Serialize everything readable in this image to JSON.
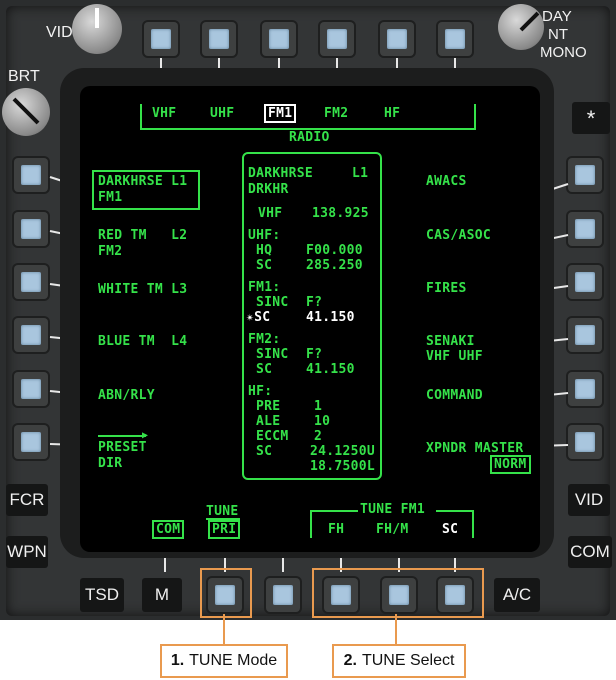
{
  "bezel": {
    "vid_knob": "VID",
    "brt_knob": "BRT",
    "mode_knob": {
      "day": "DAY",
      "nt": "NT",
      "mono": "MONO"
    },
    "asterisk": "*",
    "left_labels": {
      "fcr": "FCR",
      "wpn": "WPN"
    },
    "right_labels": {
      "vid": "VID",
      "com": "COM"
    },
    "bottom_labels": {
      "tsd": "TSD",
      "m": "M",
      "ac": "A/C"
    }
  },
  "screen": {
    "top_tabs": [
      "VHF",
      "UHF",
      "FM1",
      "FM2",
      "HF"
    ],
    "top_selected": "FM1",
    "page_title": "RADIO",
    "left": {
      "l1_line1": "DARKHRSE L1",
      "l1_line2": "FM1",
      "l2_line1": "RED TM   L2",
      "l2_line2": "FM2",
      "l3": "WHITE TM L3",
      "l4": "BLUE TM  L4",
      "l5": "ABN/RLY",
      "l6_line1": "PRESET",
      "l6_line2": "DIR"
    },
    "right": {
      "r1": "AWACS",
      "r2": "CAS/ASOC",
      "r3": "FIRES",
      "r4_line1": "SENAKI",
      "r4_line2": "VHF UHF",
      "r5": "COMMAND",
      "r6": "XPNDR MASTER",
      "r6_status": "NORM"
    },
    "center": {
      "net_name": "DARKHRSE",
      "net_slot": "L1",
      "net_short": "DRKHR",
      "vhf_label": "VHF",
      "vhf_freq": "138.925",
      "uhf_label": "UHF:",
      "uhf_hq_label": "HQ",
      "uhf_hq_value": "F00.000",
      "uhf_sc_label": "SC",
      "uhf_sc_value": "285.250",
      "fm1_label": "FM1:",
      "fm1_sinc_label": "SINC",
      "fm1_sinc_value": "F?",
      "fm1_sc_label": "✴SC",
      "fm1_sc_value": "41.150",
      "fm2_label": "FM2:",
      "fm2_sinc_label": "SINC",
      "fm2_sinc_value": "F?",
      "fm2_sc_label": "SC",
      "fm2_sc_value": "41.150",
      "hf_label": "HF:",
      "hf_pre_label": "PRE",
      "hf_pre_value": "1",
      "hf_ale_label": "ALE",
      "hf_ale_value": "10",
      "hf_eccm_label": "ECCM",
      "hf_eccm_value": "2",
      "hf_sc_label": "SC",
      "hf_sc_value1": "24.1250U",
      "hf_sc_value2": "18.7500L"
    },
    "bottom": {
      "com": "COM",
      "tune_label": "TUNE",
      "tune_value": "PRI",
      "tune_fm1_title": "TUNE FM1",
      "fh": "FH",
      "fhm": "FH/M",
      "sc": "SC"
    }
  },
  "callouts": {
    "c1_num": "1.",
    "c1_text": "TUNE Mode",
    "c2_num": "2.",
    "c2_text": "TUNE Select"
  },
  "colors": {
    "mfd_green": "#35e24a",
    "highlight_white": "#ffffff",
    "callout_orange": "#e99a4f"
  }
}
